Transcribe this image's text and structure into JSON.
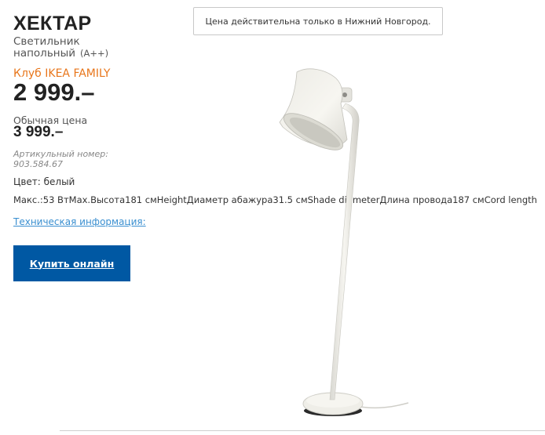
{
  "product": {
    "name": "ХЕКТАР",
    "type": "Светильник напольный",
    "energy_class": "(A++)",
    "family_club_label": "Клуб IKEA FAMILY",
    "family_price": "2 999.–",
    "regular_price_label": "Обычная цена",
    "regular_price": "3 999.–",
    "article_number": "Артикульный номер: 903.584.67",
    "color": "Цвет: белый",
    "specs": "Макс.:53 ВтMax.Высота181 смHeightДиаметр абажура31.5 смShade diameterДлина провода187 смCord length",
    "tech_info_link": "Техническая информация:",
    "buy_button_label": "Купить онлайн"
  },
  "notice": {
    "text": "Цена действительна только в Нижний Новгород."
  },
  "image": {
    "icon": "floor-lamp-image",
    "lamp_color": "#f1f0ea"
  },
  "colors": {
    "accent_orange": "#e8761b",
    "button_blue": "#0058a3",
    "link_blue": "#3a8fd0"
  }
}
